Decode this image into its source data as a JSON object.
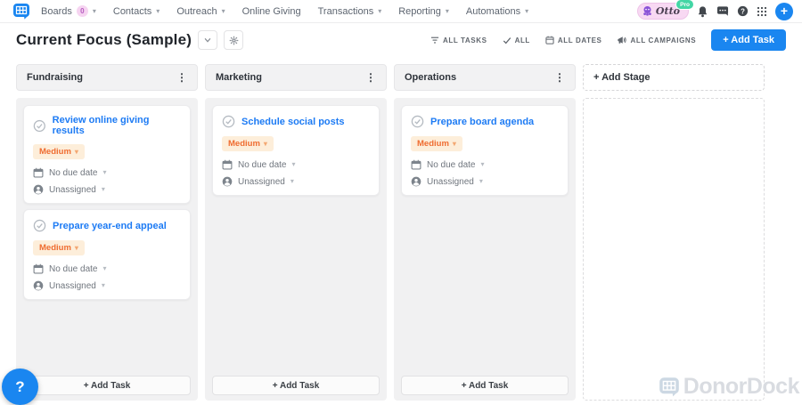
{
  "colors": {
    "accent_blue": "#1a86f0",
    "priority_bg": "#fdeeda",
    "priority_text": "#ef6c30",
    "boards_badge_bg": "#f6d4f1",
    "boards_badge_text": "#b65cc0",
    "pro_green": "#43d6a5",
    "lane_bg": "#f1f1f2",
    "watermark_gray": "#d9dce1"
  },
  "navbar": {
    "items": [
      {
        "label": "Boards",
        "badge": "0"
      },
      {
        "label": "Contacts"
      },
      {
        "label": "Outreach"
      },
      {
        "label": "Online Giving"
      },
      {
        "label": "Transactions"
      },
      {
        "label": "Reporting"
      },
      {
        "label": "Automations"
      }
    ],
    "user": {
      "name": "Otto",
      "plan": "Pro"
    }
  },
  "header": {
    "title": "Current Focus (Sample)",
    "filters": [
      {
        "label": "ALL TASKS"
      },
      {
        "label": "ALL"
      },
      {
        "label": "ALL DATES"
      },
      {
        "label": "ALL CAMPAIGNS"
      }
    ],
    "add_task_label": "+ Add Task"
  },
  "board": {
    "columns": [
      {
        "title": "Fundraising",
        "add_task_label": "+ Add Task",
        "cards": [
          {
            "title": "Review online giving results",
            "priority": "Medium",
            "due": "No due date",
            "assignee": "Unassigned"
          },
          {
            "title": "Prepare year-end appeal",
            "priority": "Medium",
            "due": "No due date",
            "assignee": "Unassigned"
          }
        ]
      },
      {
        "title": "Marketing",
        "add_task_label": "+ Add Task",
        "cards": [
          {
            "title": "Schedule social posts",
            "priority": "Medium",
            "due": "No due date",
            "assignee": "Unassigned"
          }
        ]
      },
      {
        "title": "Operations",
        "add_task_label": "+ Add Task",
        "cards": [
          {
            "title": "Prepare board agenda",
            "priority": "Medium",
            "due": "No due date",
            "assignee": "Unassigned"
          }
        ]
      }
    ],
    "add_stage_label": "+ Add Stage"
  },
  "help_button": "?",
  "watermark": "DonorDock"
}
